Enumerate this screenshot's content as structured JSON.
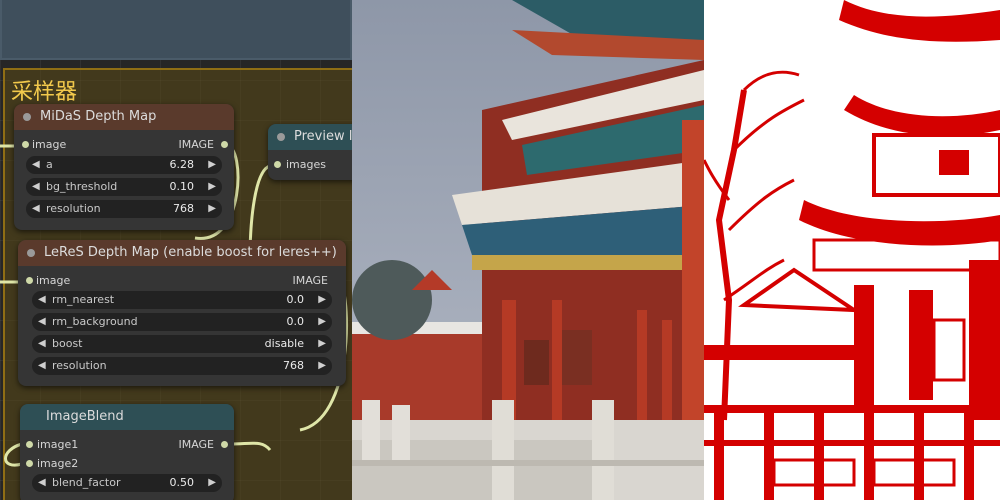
{
  "group": {
    "title": "采样器"
  },
  "midas": {
    "title": "MiDaS Depth Map",
    "input": "image",
    "output": "IMAGE",
    "widgets": [
      {
        "label": "a",
        "value": "6.28"
      },
      {
        "label": "bg_threshold",
        "value": "0.10"
      },
      {
        "label": "resolution",
        "value": "768"
      }
    ]
  },
  "preview": {
    "title": "Preview Image",
    "input": "images"
  },
  "leres": {
    "title": "LeReS Depth Map (enable boost for leres++)",
    "input": "image",
    "output": "IMAGE",
    "widgets": [
      {
        "label": "rm_nearest",
        "value": "0.0"
      },
      {
        "label": "rm_background",
        "value": "0.0"
      },
      {
        "label": "boost",
        "value": "disable"
      },
      {
        "label": "resolution",
        "value": "768"
      }
    ]
  },
  "blend": {
    "title": "ImageBlend",
    "inputs": [
      "image1",
      "image2"
    ],
    "output": "IMAGE",
    "widgets": [
      {
        "label": "blend_factor",
        "value": "0.50"
      }
    ]
  },
  "icons": {
    "left": "triangle-left",
    "right": "triangle-right"
  },
  "colors": {
    "group_border": "#8f6e14",
    "group_title": "#f2c94c",
    "wire": "#dfe6a8",
    "papercut_red": "#d40000"
  }
}
